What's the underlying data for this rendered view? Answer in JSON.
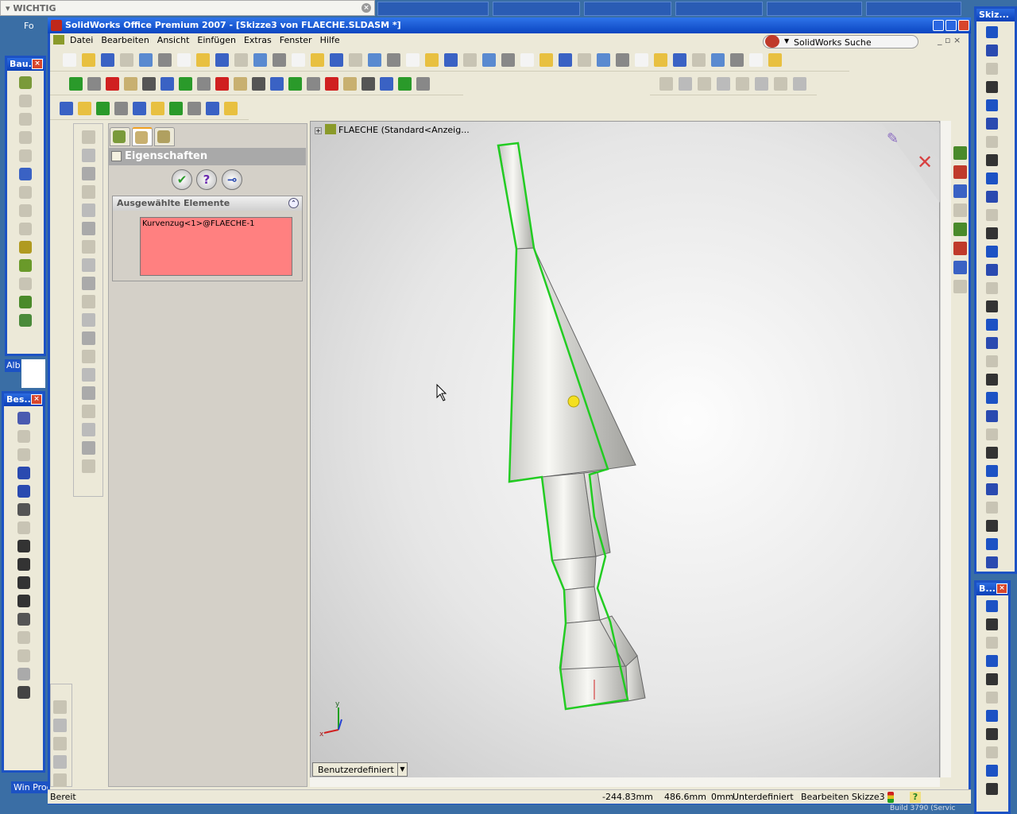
{
  "desktop": {
    "search_strip": "WICHTIG",
    "left_label_alb": "Alb",
    "left_label_winproc": "Win Proc",
    "fo_label": "Fo",
    "build_label": "Build 3790 (Servic"
  },
  "palettes": {
    "bau": "Bau...",
    "bes": "Bes...",
    "skiz": "Skiz...",
    "b": "B..."
  },
  "window": {
    "title": "SolidWorks Office Premium 2007 - [Skizze3 von FLAECHE.SLDASM *]"
  },
  "menu": [
    "Datei",
    "Bearbeiten",
    "Ansicht",
    "Einfügen",
    "Extras",
    "Fenster",
    "Hilfe"
  ],
  "search": {
    "label": "SolidWorks Suche"
  },
  "property_manager": {
    "title": "Eigenschaften",
    "ok": "✔",
    "help": "?",
    "pin": "⊸",
    "group_title": "Ausgewählte Elemente",
    "selected_items": [
      "Kurvenzug<1>@FLAECHE-1"
    ]
  },
  "viewport": {
    "tree_root": "FLAECHE  (Standard<Anzeig...",
    "configuration": "Benutzerdefiniert",
    "triad": {
      "x": "x",
      "y": "y"
    }
  },
  "status": {
    "ready": "Bereit",
    "x": "-244.83mm",
    "y": "486.6mm",
    "z": "0mm",
    "state": "Unterdefiniert",
    "mode": "Bearbeiten Skizze3"
  },
  "colors": {
    "accent": "#1c52c4",
    "selection": "#ff8080",
    "outline": "#22cc22"
  }
}
